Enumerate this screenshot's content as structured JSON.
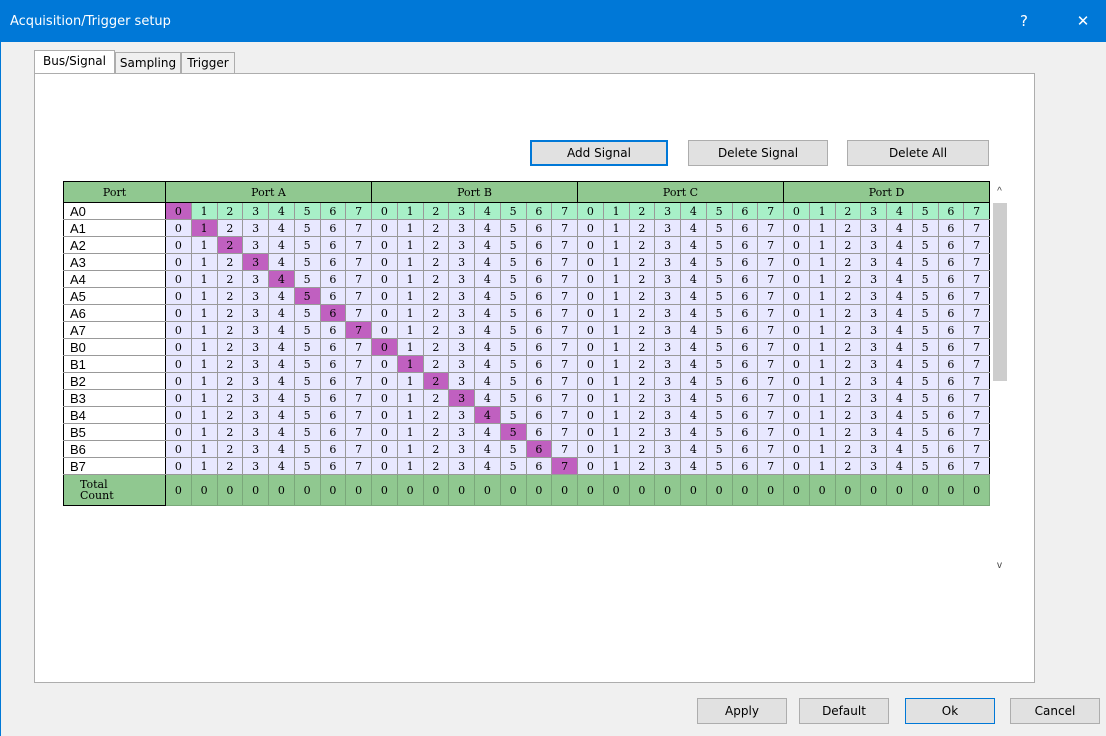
{
  "window": {
    "title": "Acquisition/Trigger setup",
    "help_glyph": "?",
    "close_glyph": "✕",
    "accent_color": "#0078d7"
  },
  "tabs": [
    {
      "label": "Bus/Signal",
      "active": true
    },
    {
      "label": "Sampling",
      "active": false
    },
    {
      "label": "Trigger",
      "active": false
    }
  ],
  "actions": {
    "add_signal": "Add Signal",
    "delete_signal": "Delete Signal",
    "delete_all": "Delete All"
  },
  "grid": {
    "port_header": "Port",
    "ports": [
      "Port A",
      "Port B",
      "Port C",
      "Port D"
    ],
    "bits": [
      "0",
      "1",
      "2",
      "3",
      "4",
      "5",
      "6",
      "7"
    ],
    "signals": [
      "A0",
      "A1",
      "A2",
      "A3",
      "A4",
      "A5",
      "A6",
      "A7",
      "B0",
      "B1",
      "B2",
      "B3",
      "B4",
      "B5",
      "B6",
      "B7"
    ],
    "total_label_line1": "Total",
    "total_label_line2": "Count",
    "total_counts": [
      "0",
      "0",
      "0",
      "0",
      "0",
      "0",
      "0",
      "0",
      "0",
      "0",
      "0",
      "0",
      "0",
      "0",
      "0",
      "0",
      "0",
      "0",
      "0",
      "0",
      "0",
      "0",
      "0",
      "0",
      "0",
      "0",
      "0",
      "0",
      "0",
      "0",
      "0",
      "0"
    ],
    "selected_color": "#c060c0",
    "header_color": "#90c890",
    "first_row_color": "#a8f0c8",
    "cell_color": "#e8e8ff"
  },
  "footer": {
    "apply": "Apply",
    "default": "Default",
    "ok": "Ok",
    "cancel": "Cancel"
  },
  "scrollbar": {
    "up_glyph": "^",
    "down_glyph": "v"
  }
}
